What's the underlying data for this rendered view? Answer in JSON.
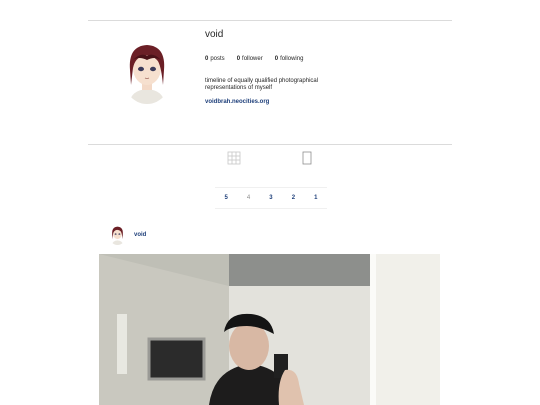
{
  "profile": {
    "username": "void",
    "stats": {
      "posts_count": "0",
      "posts_label": "posts",
      "followers_count": "0",
      "followers_label": "follower",
      "following_count": "0",
      "following_label": "following"
    },
    "bio": "timeline of equally qualified photographical representations of myself",
    "website": "voidbrah.neocities.org"
  },
  "view_toggle": {
    "grid_icon": "grid-icon",
    "single_icon": "single-post-icon"
  },
  "pagination": {
    "pages": [
      "5",
      "4",
      "3",
      "2",
      "1"
    ],
    "current": "4"
  },
  "post": {
    "username": "void"
  },
  "colors": {
    "link": "#1e3f7a",
    "border": "#dbdbdb",
    "muted": "#8e8e8e"
  }
}
